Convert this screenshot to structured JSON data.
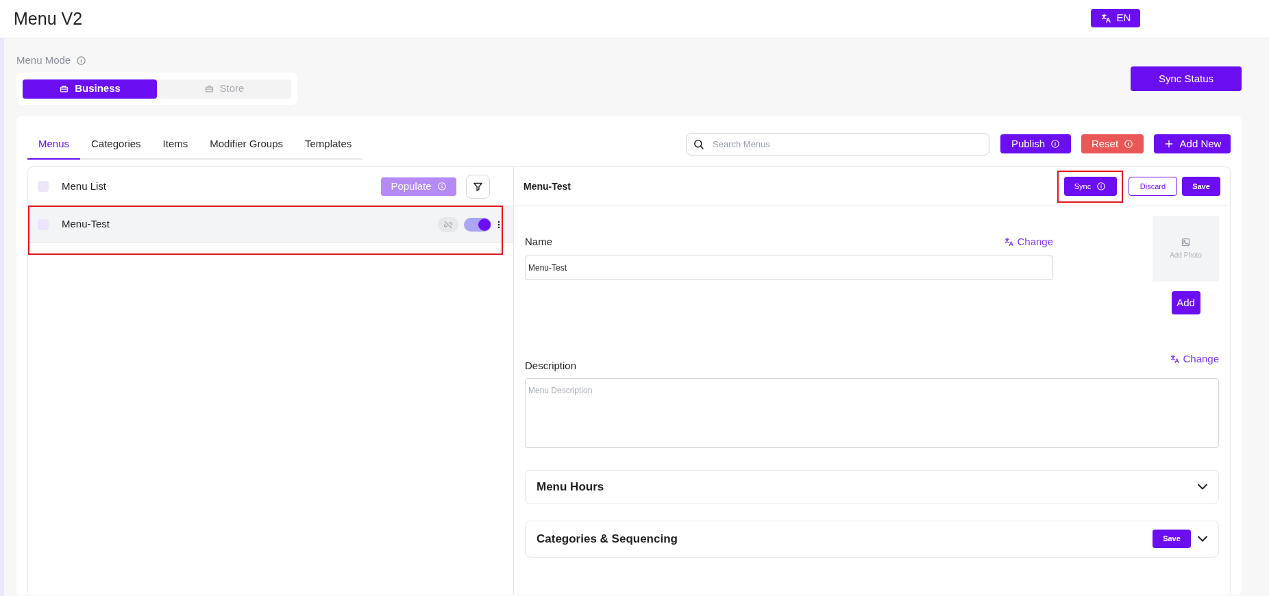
{
  "header": {
    "title": "Menu V2",
    "language_button": "EN"
  },
  "menu_mode": {
    "label": "Menu Mode",
    "options": [
      {
        "label": "Business",
        "selected": true
      },
      {
        "label": "Store",
        "selected": false
      }
    ]
  },
  "sync_status_button": "Sync Status",
  "tabs": [
    {
      "label": "Menus",
      "selected": true
    },
    {
      "label": "Categories",
      "selected": false
    },
    {
      "label": "Items",
      "selected": false
    },
    {
      "label": "Modifier Groups",
      "selected": false
    },
    {
      "label": "Templates",
      "selected": false
    }
  ],
  "search": {
    "placeholder": "Search Menus"
  },
  "actions": [
    "Publish",
    "Reset",
    "Add New"
  ],
  "menu_list": {
    "title": "Menu List",
    "checked": false,
    "populate_button": "Populate",
    "rows": [
      {
        "name": "Menu-Test",
        "checked": false,
        "on": true,
        "highlighted": true
      }
    ]
  },
  "detail": {
    "title": "Menu-Test",
    "buttons": {
      "sync": "Sync",
      "discard": "Discard",
      "save": "Save"
    },
    "sync_highlighted": true,
    "name_label": "Name",
    "name_change": "Change",
    "name_value": "Menu-Test",
    "photo_label": "Add Photo",
    "photo_add": "Add",
    "description_label": "Description",
    "description_change": "Change",
    "description_placeholder": "Menu Description",
    "sections": [
      {
        "title": "Menu Hours",
        "expanded": false
      },
      {
        "title": "Categories & Sequencing",
        "expanded": false,
        "save": "Save"
      }
    ]
  }
}
